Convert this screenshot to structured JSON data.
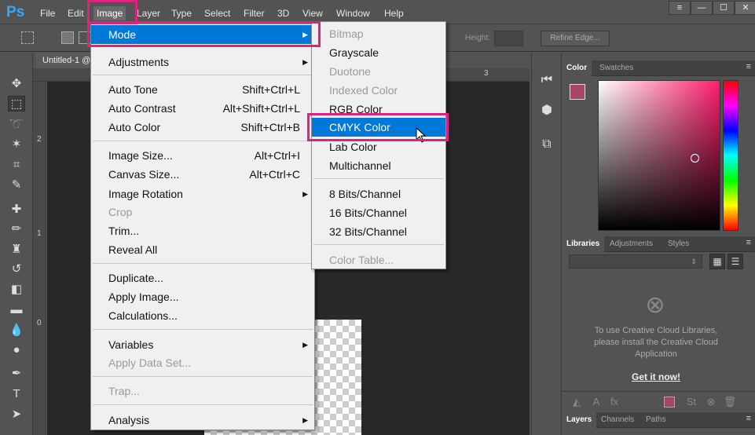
{
  "app": {
    "logo": "Ps"
  },
  "menubar": [
    "File",
    "Edit",
    "Image",
    "Layer",
    "Type",
    "Select",
    "Filter",
    "3D",
    "View",
    "Window",
    "Help"
  ],
  "window_controls": [
    "≡",
    "—",
    "☐",
    "✕"
  ],
  "options_bar": {
    "height_label": "Height:",
    "refine_edge": "Refine Edge..."
  },
  "document_tab": "Untitled-1 @",
  "rulers": {
    "top": [
      "3"
    ],
    "left": [
      "2",
      "1",
      "0"
    ]
  },
  "image_menu": {
    "items": [
      {
        "label": "Mode",
        "shortcut": "",
        "submenu": true,
        "disabled": false
      },
      {
        "label": "Adjustments",
        "shortcut": "",
        "submenu": true,
        "disabled": false
      },
      {
        "label": "Auto Tone",
        "shortcut": "Shift+Ctrl+L",
        "submenu": false,
        "disabled": false
      },
      {
        "label": "Auto Contrast",
        "shortcut": "Alt+Shift+Ctrl+L",
        "submenu": false,
        "disabled": false
      },
      {
        "label": "Auto Color",
        "shortcut": "Shift+Ctrl+B",
        "submenu": false,
        "disabled": false
      },
      {
        "label": "Image Size...",
        "shortcut": "Alt+Ctrl+I",
        "submenu": false,
        "disabled": false
      },
      {
        "label": "Canvas Size...",
        "shortcut": "Alt+Ctrl+C",
        "submenu": false,
        "disabled": false
      },
      {
        "label": "Image Rotation",
        "shortcut": "",
        "submenu": true,
        "disabled": false
      },
      {
        "label": "Crop",
        "shortcut": "",
        "submenu": false,
        "disabled": true
      },
      {
        "label": "Trim...",
        "shortcut": "",
        "submenu": false,
        "disabled": false
      },
      {
        "label": "Reveal All",
        "shortcut": "",
        "submenu": false,
        "disabled": false
      },
      {
        "label": "Duplicate...",
        "shortcut": "",
        "submenu": false,
        "disabled": false
      },
      {
        "label": "Apply Image...",
        "shortcut": "",
        "submenu": false,
        "disabled": false
      },
      {
        "label": "Calculations...",
        "shortcut": "",
        "submenu": false,
        "disabled": false
      },
      {
        "label": "Variables",
        "shortcut": "",
        "submenu": true,
        "disabled": false
      },
      {
        "label": "Apply Data Set...",
        "shortcut": "",
        "submenu": false,
        "disabled": true
      },
      {
        "label": "Trap...",
        "shortcut": "",
        "submenu": false,
        "disabled": true
      },
      {
        "label": "Analysis",
        "shortcut": "",
        "submenu": true,
        "disabled": false
      }
    ]
  },
  "mode_submenu": {
    "items": [
      {
        "label": "Bitmap",
        "disabled": true
      },
      {
        "label": "Grayscale",
        "disabled": false
      },
      {
        "label": "Duotone",
        "disabled": true
      },
      {
        "label": "Indexed Color",
        "disabled": true
      },
      {
        "label": "RGB Color",
        "disabled": false
      },
      {
        "label": "CMYK Color",
        "disabled": false
      },
      {
        "label": "Lab Color",
        "disabled": false
      },
      {
        "label": "Multichannel",
        "disabled": false
      },
      {
        "label": "8 Bits/Channel",
        "disabled": false
      },
      {
        "label": "16 Bits/Channel",
        "disabled": false
      },
      {
        "label": "32 Bits/Channel",
        "disabled": false
      },
      {
        "label": "Color Table...",
        "disabled": true
      }
    ]
  },
  "color_panel": {
    "tabs": [
      "Color",
      "Swatches"
    ],
    "foreground": "#a8466a",
    "background": "#ffffff"
  },
  "libraries_panel": {
    "tabs": [
      "Libraries",
      "Adjustments",
      "Styles"
    ],
    "message": "To use Creative Cloud Libraries, please install the Creative Cloud Application",
    "link": "Get it now!"
  },
  "layers_panel": {
    "tabs": [
      "Layers",
      "Channels",
      "Paths"
    ]
  },
  "colors": {
    "highlight": "#0078d7",
    "annotation": "#e0227f"
  }
}
